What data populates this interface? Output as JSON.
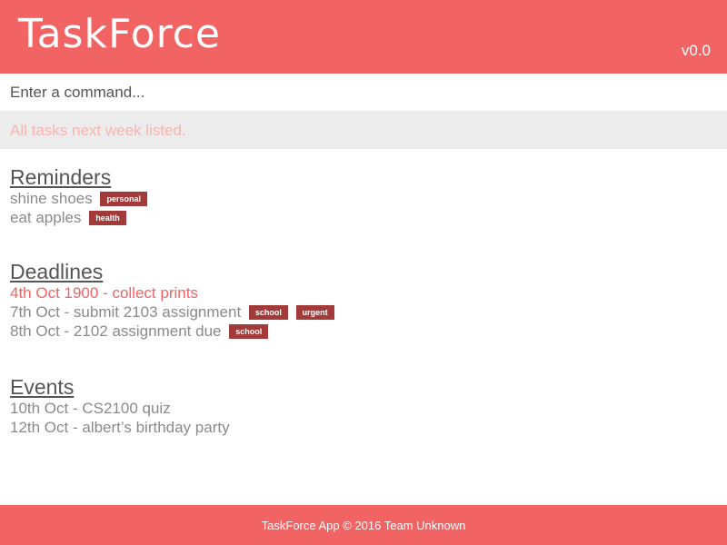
{
  "header": {
    "title": "TaskForce",
    "version": "v0.0"
  },
  "command": {
    "placeholder": "Enter a command..."
  },
  "result": {
    "message": "All tasks next week listed."
  },
  "reminders": {
    "title": "Reminders",
    "items": [
      {
        "text": "shine shoes",
        "tags": [
          "personal"
        ]
      },
      {
        "text": "eat apples",
        "tags": [
          "health"
        ]
      }
    ]
  },
  "deadlines": {
    "title": "Deadlines",
    "items": [
      {
        "text": "4th Oct 1900 - collect prints",
        "tags": [],
        "overdue": true
      },
      {
        "text": "7th Oct - submit 2103 assignment",
        "tags": [
          "school",
          "urgent"
        ]
      },
      {
        "text": "8th Oct - 2102 assignment due",
        "tags": [
          "school"
        ]
      }
    ]
  },
  "events": {
    "title": "Events",
    "items": [
      {
        "text": "10th Oct - CS2100 quiz",
        "tags": []
      },
      {
        "text": "12th Oct - albert’s birthday party",
        "tags": []
      }
    ]
  },
  "footer": {
    "text": "TaskForce App ©  2016 Team Unknown"
  },
  "colors": {
    "brand": "#f26363",
    "tag": "#a33a3a",
    "result_text": "#f7b3b3",
    "overdue": "#f26363"
  }
}
